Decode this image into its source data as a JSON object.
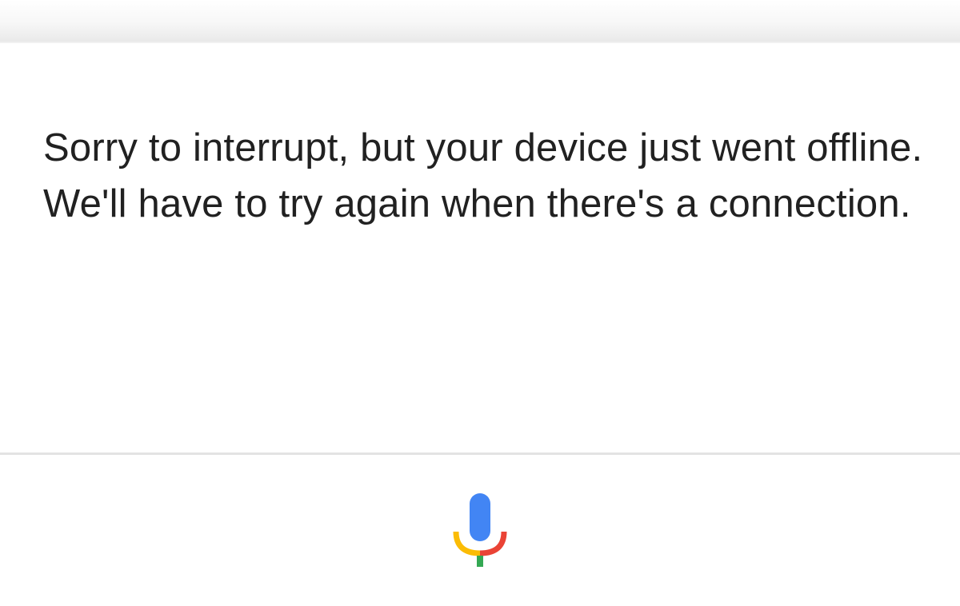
{
  "assistant": {
    "message": "Sorry to interrupt, but your device just went offline. We'll have to try again when there's a connection."
  },
  "mic": {
    "icon": "microphone-icon",
    "colors": {
      "capsule": "#4285F4",
      "left_arc": "#FBBC05",
      "right_arc": "#EA4335",
      "stem": "#34A853"
    }
  }
}
